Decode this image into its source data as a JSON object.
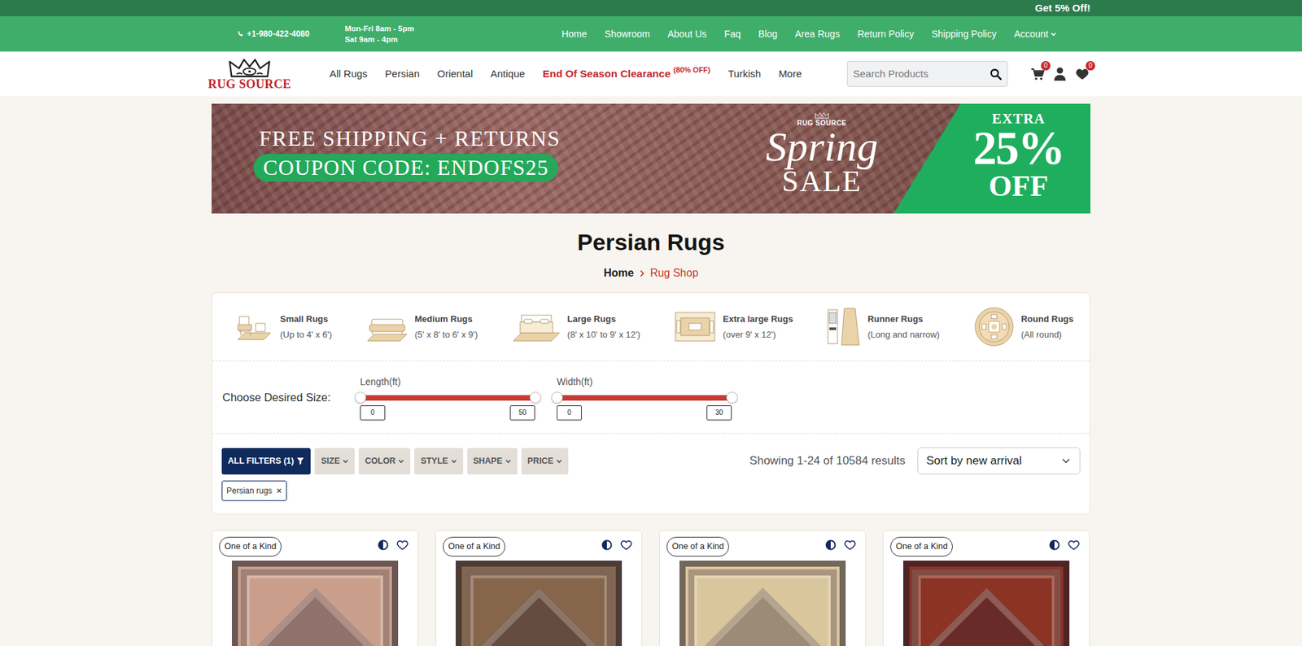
{
  "promo": {
    "text": "Get 5% Off!"
  },
  "contact": {
    "phone": "+1-980-422-4080",
    "hours": [
      "Mon-Fri 8am - 5pm",
      "Sat 9am - 4pm"
    ]
  },
  "top_links": [
    {
      "label": "Home",
      "kind": "link"
    },
    {
      "label": "Showroom",
      "kind": "link"
    },
    {
      "label": "About Us",
      "kind": "link"
    },
    {
      "label": "Faq",
      "kind": "link"
    },
    {
      "label": "Blog",
      "kind": "link"
    },
    {
      "label": "Area Rugs",
      "kind": "link"
    },
    {
      "label": "Return Policy",
      "kind": "link"
    },
    {
      "label": "Shipping Policy",
      "kind": "link"
    },
    {
      "label": "Account",
      "kind": "menu"
    }
  ],
  "logo": {
    "text": "RUG SOURCE"
  },
  "main_nav": [
    {
      "label": "All Rugs",
      "kind": "link"
    },
    {
      "label": "Persian",
      "kind": "link"
    },
    {
      "label": "Oriental",
      "kind": "link"
    },
    {
      "label": "Antique",
      "kind": "link"
    },
    {
      "label": "End Of Season Clearance",
      "note": "(80% OFF)",
      "kind": "sale"
    },
    {
      "label": "Turkish",
      "kind": "link"
    },
    {
      "label": "More",
      "kind": "link"
    }
  ],
  "search": {
    "placeholder": "Search Products"
  },
  "cart": {
    "count": "0"
  },
  "wishlist": {
    "count": "0"
  },
  "banner": {
    "line1": "FREE SHIPPING + RETURNS",
    "coupon": "COUPON CODE: ENDOFS25",
    "brand": "RUG SOURCE",
    "script": "Spring",
    "sale": "SALE",
    "extra": "EXTRA",
    "percent": "25%",
    "off": "OFF"
  },
  "page_title": "Persian Rugs",
  "breadcrumb": [
    {
      "label": "Home",
      "selected": false
    },
    {
      "label": "Rug Shop",
      "selected": true
    }
  ],
  "size_categories": [
    {
      "title": "Small Rugs",
      "range": "(Up to 4' x 6')"
    },
    {
      "title": "Medium Rugs",
      "range": "(5' x 8' to 6' x 9')"
    },
    {
      "title": "Large Rugs",
      "range": "(8' x 10' to 9' x 12')"
    },
    {
      "title": "Extra large Rugs",
      "range": "(over 9' x 12')"
    },
    {
      "title": "Runner Rugs",
      "range": "(Long and narrow)"
    },
    {
      "title": "Round Rugs",
      "range": "(All round)"
    }
  ],
  "size_picker": {
    "label": "Choose Desired Size:",
    "sliders": [
      {
        "label": "Length(ft)",
        "min": "0",
        "max": "50",
        "level": 1
      },
      {
        "label": "Width(ft)",
        "min": "0",
        "max": "30",
        "level": 1
      }
    ]
  },
  "filters": [
    {
      "label": "ALL FILTERS (1)",
      "kind": "all"
    },
    {
      "label": "SIZE",
      "kind": "dropdown"
    },
    {
      "label": "COLOR",
      "kind": "dropdown"
    },
    {
      "label": "STYLE",
      "kind": "dropdown"
    },
    {
      "label": "SHAPE",
      "kind": "dropdown"
    },
    {
      "label": "PRICE",
      "kind": "dropdown"
    }
  ],
  "results": "Showing 1-24 of 10584 results",
  "sort": {
    "value": "Sort by new arrival"
  },
  "active_filters": [
    {
      "label": "Persian rugs",
      "remove": "×"
    }
  ],
  "products": [
    {
      "tag": "One of a Kind",
      "favorite": false,
      "color": "#c99f8c"
    },
    {
      "tag": "One of a Kind",
      "favorite": false,
      "color": "#86664a"
    },
    {
      "tag": "One of a Kind",
      "favorite": false,
      "color": "#dac69c"
    },
    {
      "tag": "One of a Kind",
      "favorite": false,
      "color": "#8b3425"
    }
  ]
}
